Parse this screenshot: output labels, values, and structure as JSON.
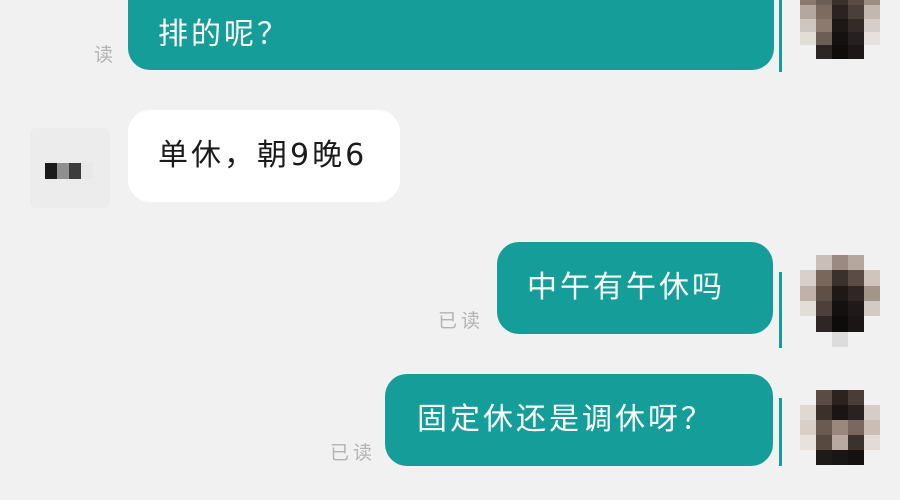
{
  "messages": [
    {
      "id": 1,
      "sender": "me",
      "text": "排的呢？",
      "receipt": "读"
    },
    {
      "id": 2,
      "sender": "other",
      "text": "单休，朝9晚6"
    },
    {
      "id": 3,
      "sender": "me",
      "text": "中午有午休吗",
      "receipt": "已读"
    },
    {
      "id": 4,
      "sender": "me",
      "text": "固定休还是调休呀？",
      "receipt": "已读"
    }
  ],
  "colors": {
    "outgoing_bubble": "#159e99",
    "incoming_bubble": "#ffffff",
    "background": "#f1f1f1",
    "receipt_text": "#b3b3b3"
  }
}
